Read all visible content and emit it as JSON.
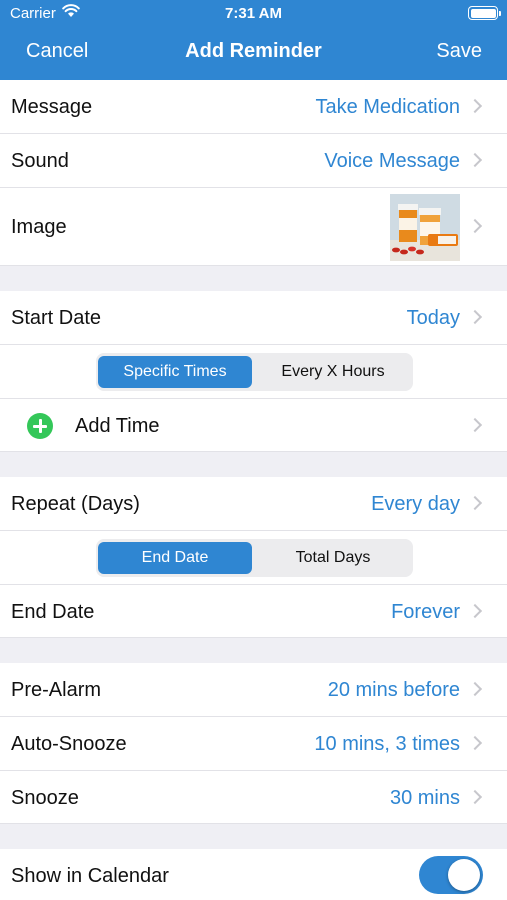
{
  "status_bar": {
    "carrier": "Carrier",
    "time": "7:31 AM"
  },
  "nav": {
    "cancel": "Cancel",
    "title": "Add Reminder",
    "save": "Save"
  },
  "group1": {
    "message": {
      "label": "Message",
      "value": "Take Medication"
    },
    "sound": {
      "label": "Sound",
      "value": "Voice Message"
    },
    "image": {
      "label": "Image",
      "thumbnail": "medication-bottles"
    }
  },
  "group2": {
    "start_date": {
      "label": "Start Date",
      "value": "Today"
    },
    "time_mode": {
      "options": [
        "Specific Times",
        "Every X Hours"
      ],
      "selected": "Specific Times"
    },
    "add_time": {
      "label": "Add Time"
    }
  },
  "group3": {
    "repeat": {
      "label": "Repeat (Days)",
      "value": "Every day"
    },
    "end_mode": {
      "options": [
        "End Date",
        "Total Days"
      ],
      "selected": "End Date"
    },
    "end_date": {
      "label": "End Date",
      "value": "Forever"
    }
  },
  "group4": {
    "pre_alarm": {
      "label": "Pre-Alarm",
      "value": "20 mins before"
    },
    "auto_snooze": {
      "label": "Auto-Snooze",
      "value": "10 mins, 3 times"
    },
    "snooze": {
      "label": "Snooze",
      "value": "30 mins"
    }
  },
  "group5": {
    "show_in_calendar": {
      "label": "Show in Calendar",
      "enabled": true
    }
  },
  "colors": {
    "accent": "#2f86d2",
    "add_icon": "#34c759",
    "background": "#efeff4",
    "chevron": "#c7c7cc"
  }
}
